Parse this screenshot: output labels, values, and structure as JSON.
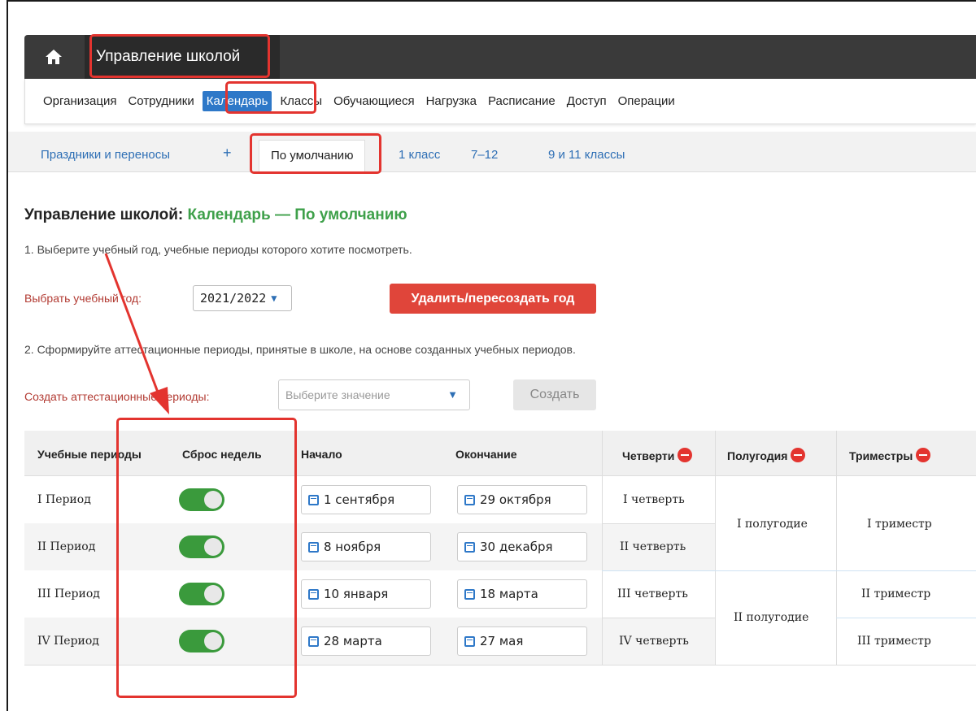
{
  "app": {
    "title": "Управление школой"
  },
  "menu": {
    "items": [
      "Организация",
      "Сотрудники",
      "Календарь",
      "Классы",
      "Обучающиеся",
      "Нагрузка",
      "Расписание",
      "Доступ",
      "Операции"
    ],
    "active": "Календарь"
  },
  "tabs": {
    "holidays": "Праздники и переносы",
    "add": "+",
    "default": "По умолчанию",
    "class1": "1 класс",
    "class7_12": "7–12",
    "class9_11": "9 и 11 классы"
  },
  "page": {
    "title_prefix": "Управление школой:",
    "title_suffix": "Календарь — По умолчанию",
    "step1": "1. Выберите учебный год, учебные периоды которого хотите посмотреть.",
    "year_label": "Выбрать учебный год:",
    "year_value": "2021/2022",
    "delete_button": "Удалить/пересоздать год",
    "step2": "2. Сформируйте аттестационные периоды, принятые в школе, на основе созданных учебных периодов.",
    "create_label": "Создать аттестационные периоды:",
    "create_placeholder": "Выберите значение",
    "create_button": "Создать"
  },
  "table": {
    "headers": [
      "Учебные периоды",
      "Сброс недель",
      "Начало",
      "Окончание",
      "Четверти",
      "Полугодия",
      "Триместры"
    ],
    "rows": [
      {
        "period": "I Период",
        "reset": true,
        "start": "1 сентября",
        "end": "29 октября",
        "quarter": "I четверть"
      },
      {
        "period": "II Период",
        "reset": true,
        "start": "8 ноября",
        "end": "30 декабря",
        "quarter": "II четверть"
      },
      {
        "period": "III Период",
        "reset": true,
        "start": "10 января",
        "end": "18 марта",
        "quarter": "III четверть"
      },
      {
        "period": "IV Период",
        "reset": true,
        "start": "28 марта",
        "end": "27 мая",
        "quarter": "IV четверть"
      }
    ],
    "halves": [
      "I полугодие",
      "II полугодие"
    ],
    "trimesters": [
      "I триместр",
      "II триместр",
      "III триместр"
    ]
  },
  "colors": {
    "accent": "#2e78c8",
    "highlight": "#e3342f",
    "toggle_on": "#3a9a3c",
    "title_green": "#3ea04a"
  }
}
